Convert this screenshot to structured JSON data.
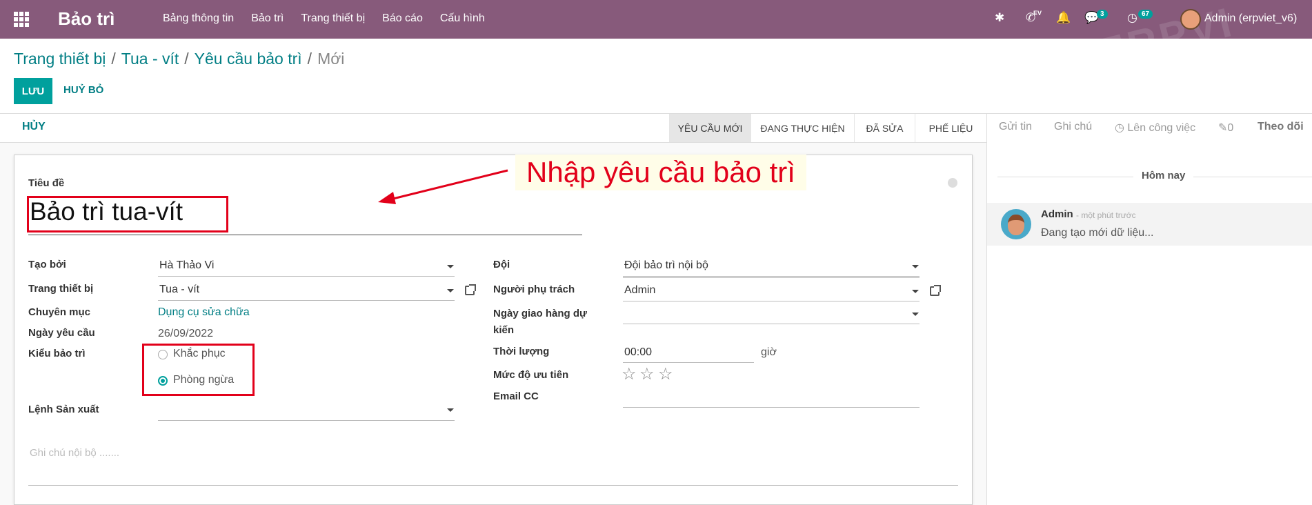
{
  "navbar": {
    "brand": "Bảo trì",
    "menu": [
      "Bảng thông tin",
      "Bảo trì",
      "Trang thiết bị",
      "Báo cáo",
      "Cấu hình"
    ],
    "messages_badge": "3",
    "activities_badge": "67",
    "ev_label": "EV",
    "user": "Admin (erpviet_v6)",
    "watermark": "ERPVI"
  },
  "breadcrumb": {
    "items": [
      "Trang thiết bị",
      "Tua - vít",
      "Yêu cầu bảo trì"
    ],
    "current": "Mới"
  },
  "buttons": {
    "save": "LƯU",
    "discard": "HUỶ BỎ",
    "cancel": "HỦY"
  },
  "stages": [
    "YÊU CẦU MỚI",
    "ĐANG THỰC HIỆN",
    "ĐÃ SỬA",
    "PHẾ LIỆU"
  ],
  "form": {
    "title_label": "Tiêu đề",
    "title_value": "Bảo trì tua-vít",
    "created_by_label": "Tạo bởi",
    "created_by_value": "Hà Thảo Vi",
    "equipment_label": "Trang thiết bị",
    "equipment_value": "Tua - vít",
    "category_label": "Chuyên mục",
    "category_value": "Dụng cụ sửa chữa",
    "request_date_label": "Ngày yêu cầu",
    "request_date_value": "26/09/2022",
    "type_label": "Kiểu bảo trì",
    "type_options": [
      "Khắc phục",
      "Phòng ngừa"
    ],
    "type_selected": "Phòng ngừa",
    "mo_label": "Lệnh Sản xuất",
    "team_label": "Đội",
    "team_value": "Đội bảo trì nội bộ",
    "responsible_label": "Người phụ trách",
    "responsible_value": "Admin",
    "delivery_label_1": "Ngày giao hàng dự",
    "delivery_label_2": "kiến",
    "duration_label": "Thời lượng",
    "duration_value": "00:00",
    "duration_unit": "giờ",
    "priority_label": "Mức độ ưu tiên",
    "email_cc_label": "Email CC",
    "internal_note_placeholder": "Ghi chú nội bộ ......."
  },
  "annotation": "Nhập yêu cầu bảo trì",
  "chatter": {
    "tabs": [
      "Gửi tin",
      "Ghi chú",
      "Lên công việc",
      "0",
      "Theo dõi"
    ],
    "date_separator": "Hôm nay",
    "message": {
      "author": "Admin",
      "time": "- một phút trước",
      "body": "Đang tạo mới dữ liệu..."
    }
  },
  "colors": {
    "navbar": "#875a7b",
    "accent": "#00a09d",
    "link": "#017e84",
    "annotation": "#e2001a"
  }
}
